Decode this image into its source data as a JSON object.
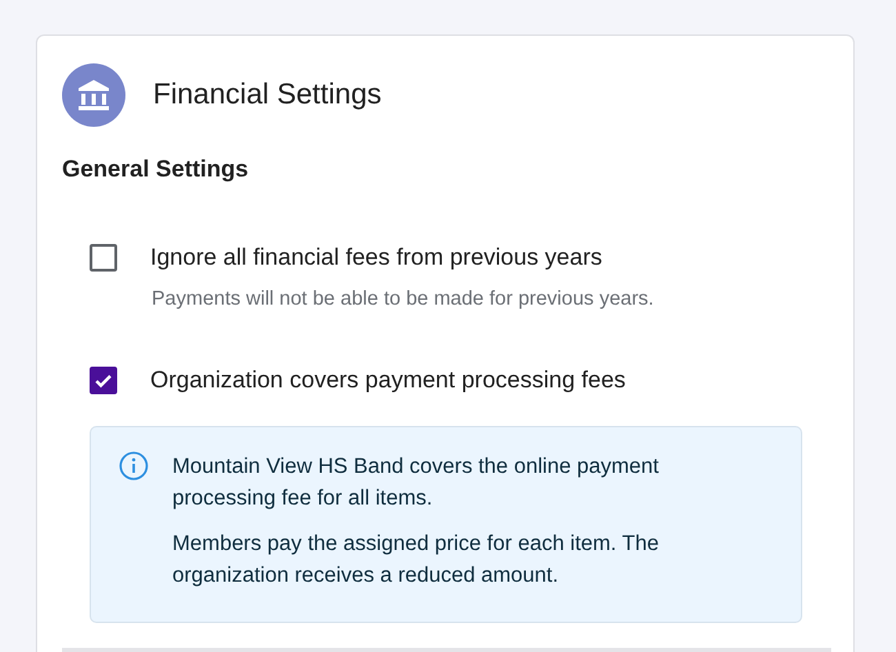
{
  "card": {
    "title": "Financial Settings",
    "section_heading": "General Settings",
    "options": [
      {
        "label": "Ignore all financial fees from previous years",
        "checked": false,
        "hint": "Payments will not be able to be made for previous years."
      },
      {
        "label": "Organization covers payment processing fees",
        "checked": true,
        "info": [
          "Mountain View HS Band covers the online payment processing fee for all items.",
          "Members pay the assigned price for each item. The organization receives a reduced amount."
        ]
      }
    ]
  }
}
